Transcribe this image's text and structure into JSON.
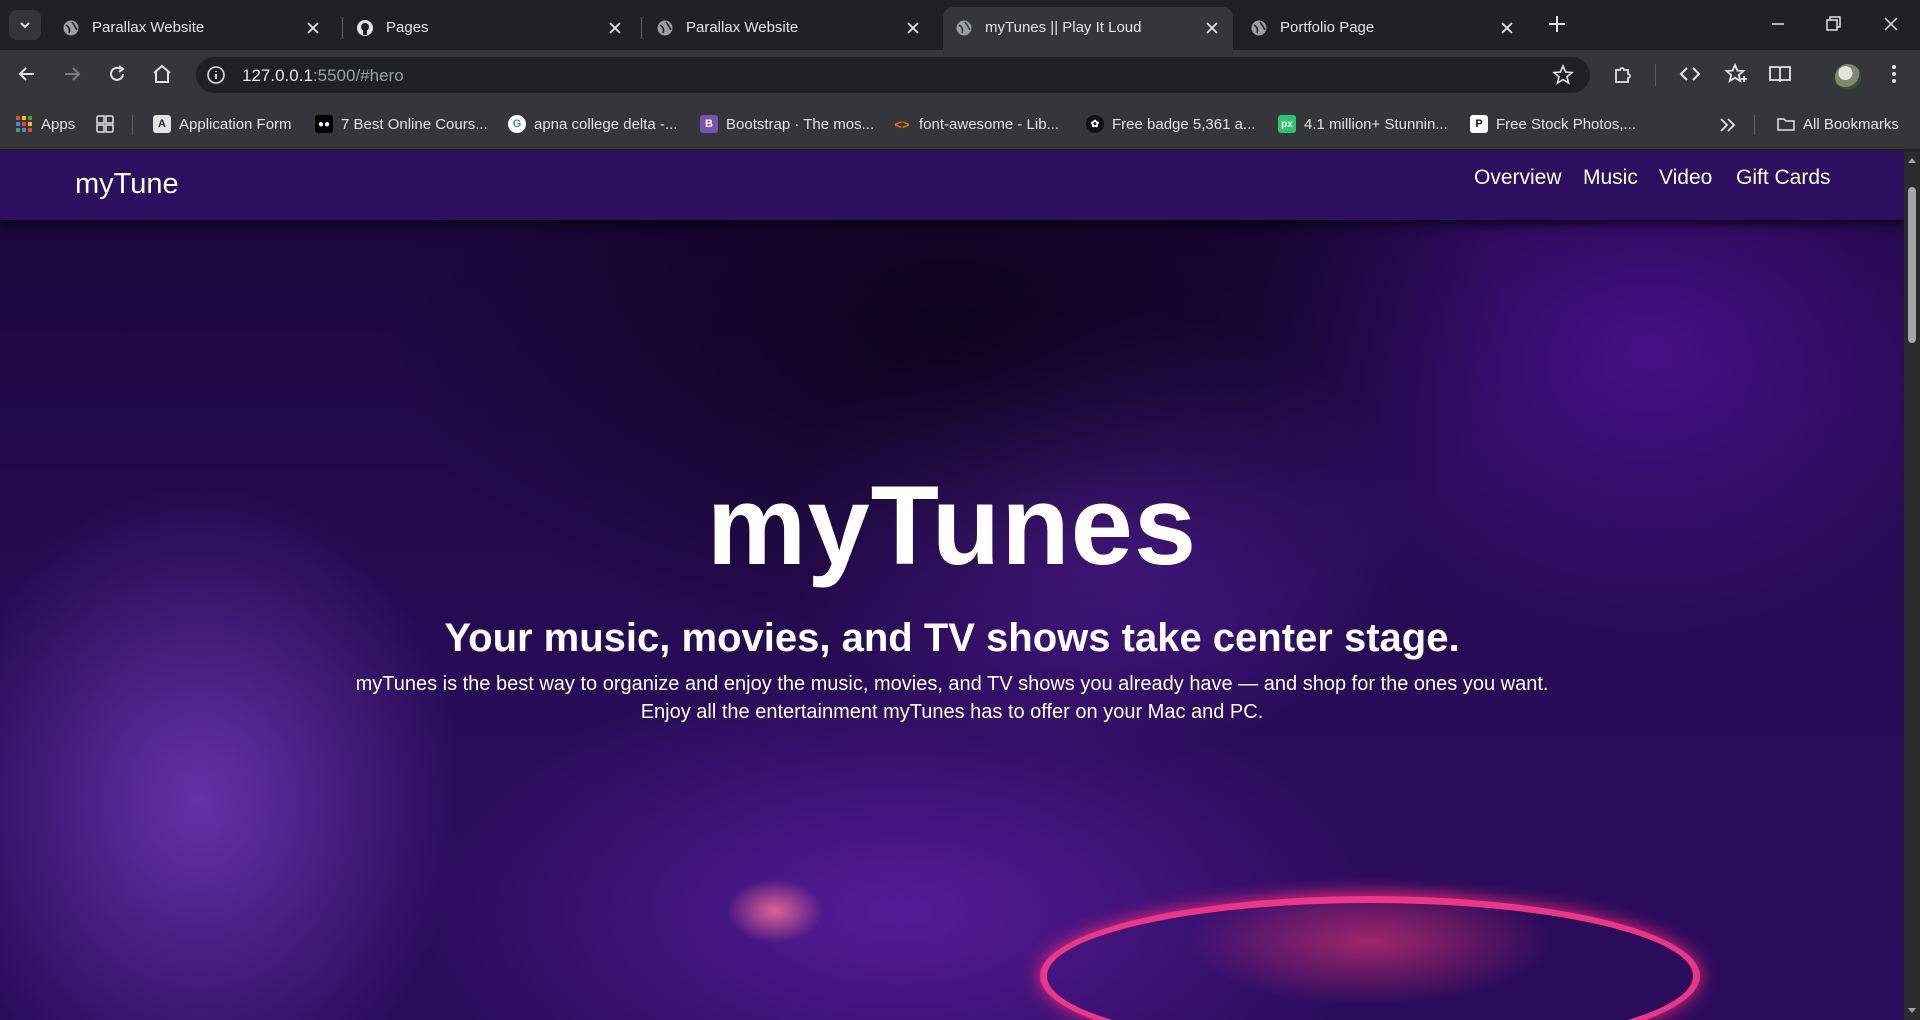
{
  "browser": {
    "tabs": [
      {
        "title": "Parallax Website",
        "favicon": "globe-icon",
        "active": false
      },
      {
        "title": "Pages",
        "favicon": "github-icon",
        "active": false
      },
      {
        "title": "Parallax Website",
        "favicon": "globe-icon",
        "active": false
      },
      {
        "title": "myTunes || Play It Loud",
        "favicon": "globe-icon",
        "active": true
      },
      {
        "title": "Portfolio Page",
        "favicon": "globe-icon",
        "active": false
      }
    ],
    "url": {
      "host": "127.0.0.1",
      "rest": ":5500/#hero"
    },
    "bookmarks": [
      {
        "label": "Apps",
        "icon": "apps-grid-icon"
      },
      {
        "label": "",
        "icon": "tab-groups-icon"
      },
      {
        "label": "Application Form",
        "icon": "app-form-icon"
      },
      {
        "label": "7 Best Online Cours...",
        "icon": "medium-icon"
      },
      {
        "label": "apna college delta -...",
        "icon": "google-icon"
      },
      {
        "label": "Bootstrap · The mos...",
        "icon": "bootstrap-icon"
      },
      {
        "label": "font-awesome - Lib...",
        "icon": "code-icon"
      },
      {
        "label": "Free badge 5,361 a...",
        "icon": "badge-icon"
      },
      {
        "label": "4.1 million+ Stunnin...",
        "icon": "pixabay-icon"
      },
      {
        "label": "Free Stock Photos,...",
        "icon": "pexels-icon"
      }
    ],
    "all_bookmarks": "All Bookmarks"
  },
  "site": {
    "logo": "myTune",
    "nav": [
      "Overview",
      "Music",
      "Video",
      "Gift Cards"
    ],
    "hero": {
      "title": "myTunes",
      "subtitle": "Your music, movies, and TV shows take center stage.",
      "desc_line1": "myTunes is the best way to organize and enjoy the music, movies, and TV shows you already have — and shop for the ones you want.",
      "desc_line2": "Enjoy all the entertainment myTunes has to offer on your Mac and PC."
    }
  },
  "colors": {
    "browser_dark": "#202124",
    "toolbar": "#35363a",
    "site_nav": "#2c0f5e",
    "hero_purple": "#2a0c5a",
    "accent_pink": "#ff3b8a"
  }
}
